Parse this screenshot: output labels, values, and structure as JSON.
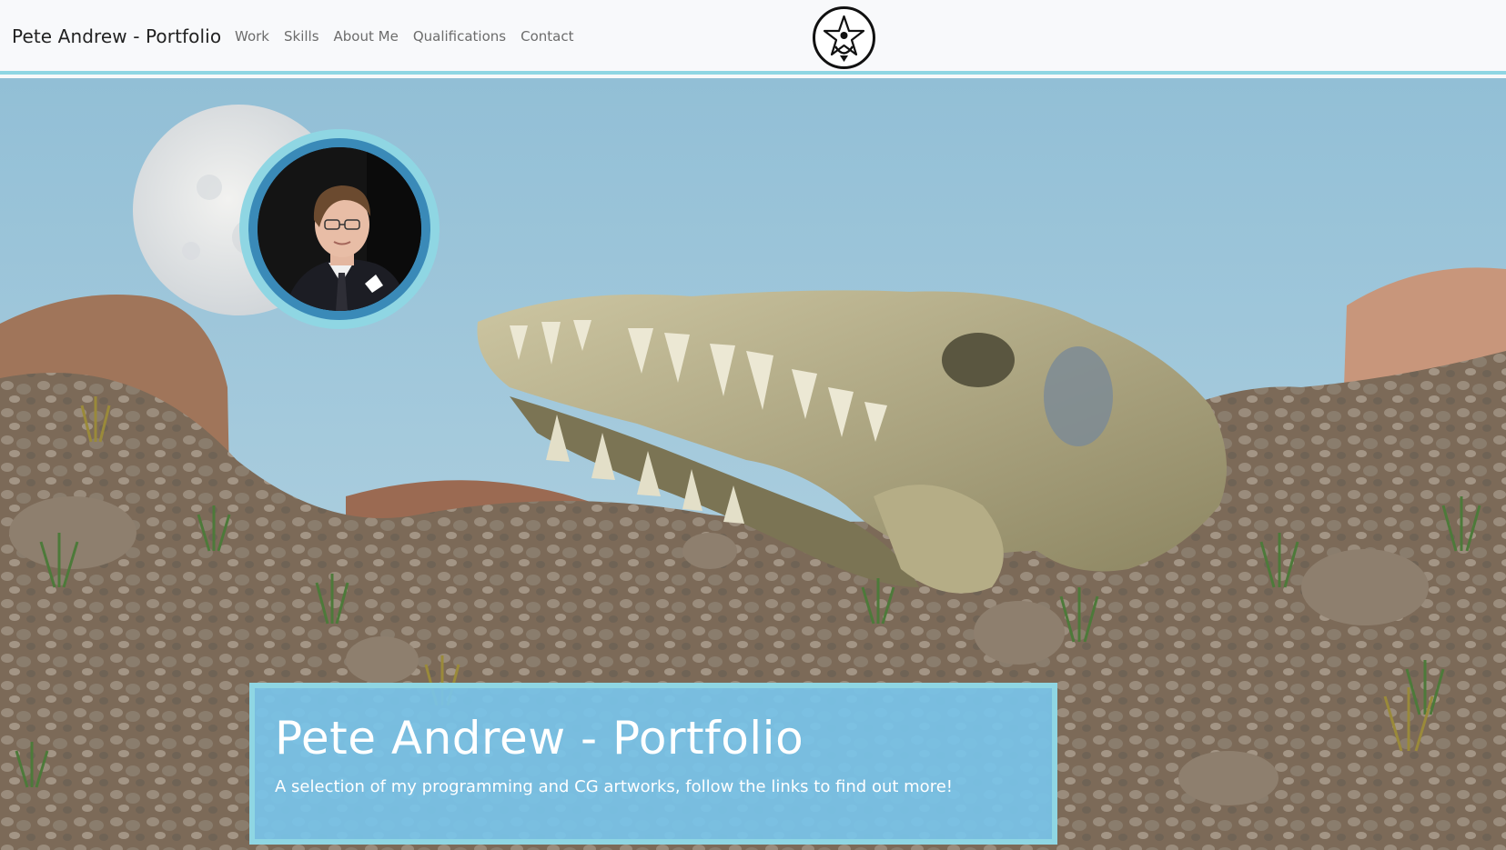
{
  "navbar": {
    "brand": "Pete Andrew - Portfolio",
    "links": [
      "Work",
      "Skills",
      "About Me",
      "Qualifications",
      "Contact"
    ],
    "logo_icon": "star-emblem-icon"
  },
  "hero": {
    "title": "Pete Andrew - Portfolio",
    "subtitle": "A selection of my programming and CG artworks, follow the links to find out more!",
    "background_image": "desert-dinosaur-skull-render",
    "avatar_image": "profile-photo"
  },
  "colors": {
    "accent": "#8fd6e3",
    "ring": "#3a8ab8",
    "caption_bg": "#78c4ea",
    "sky": "#9cc7dc"
  }
}
